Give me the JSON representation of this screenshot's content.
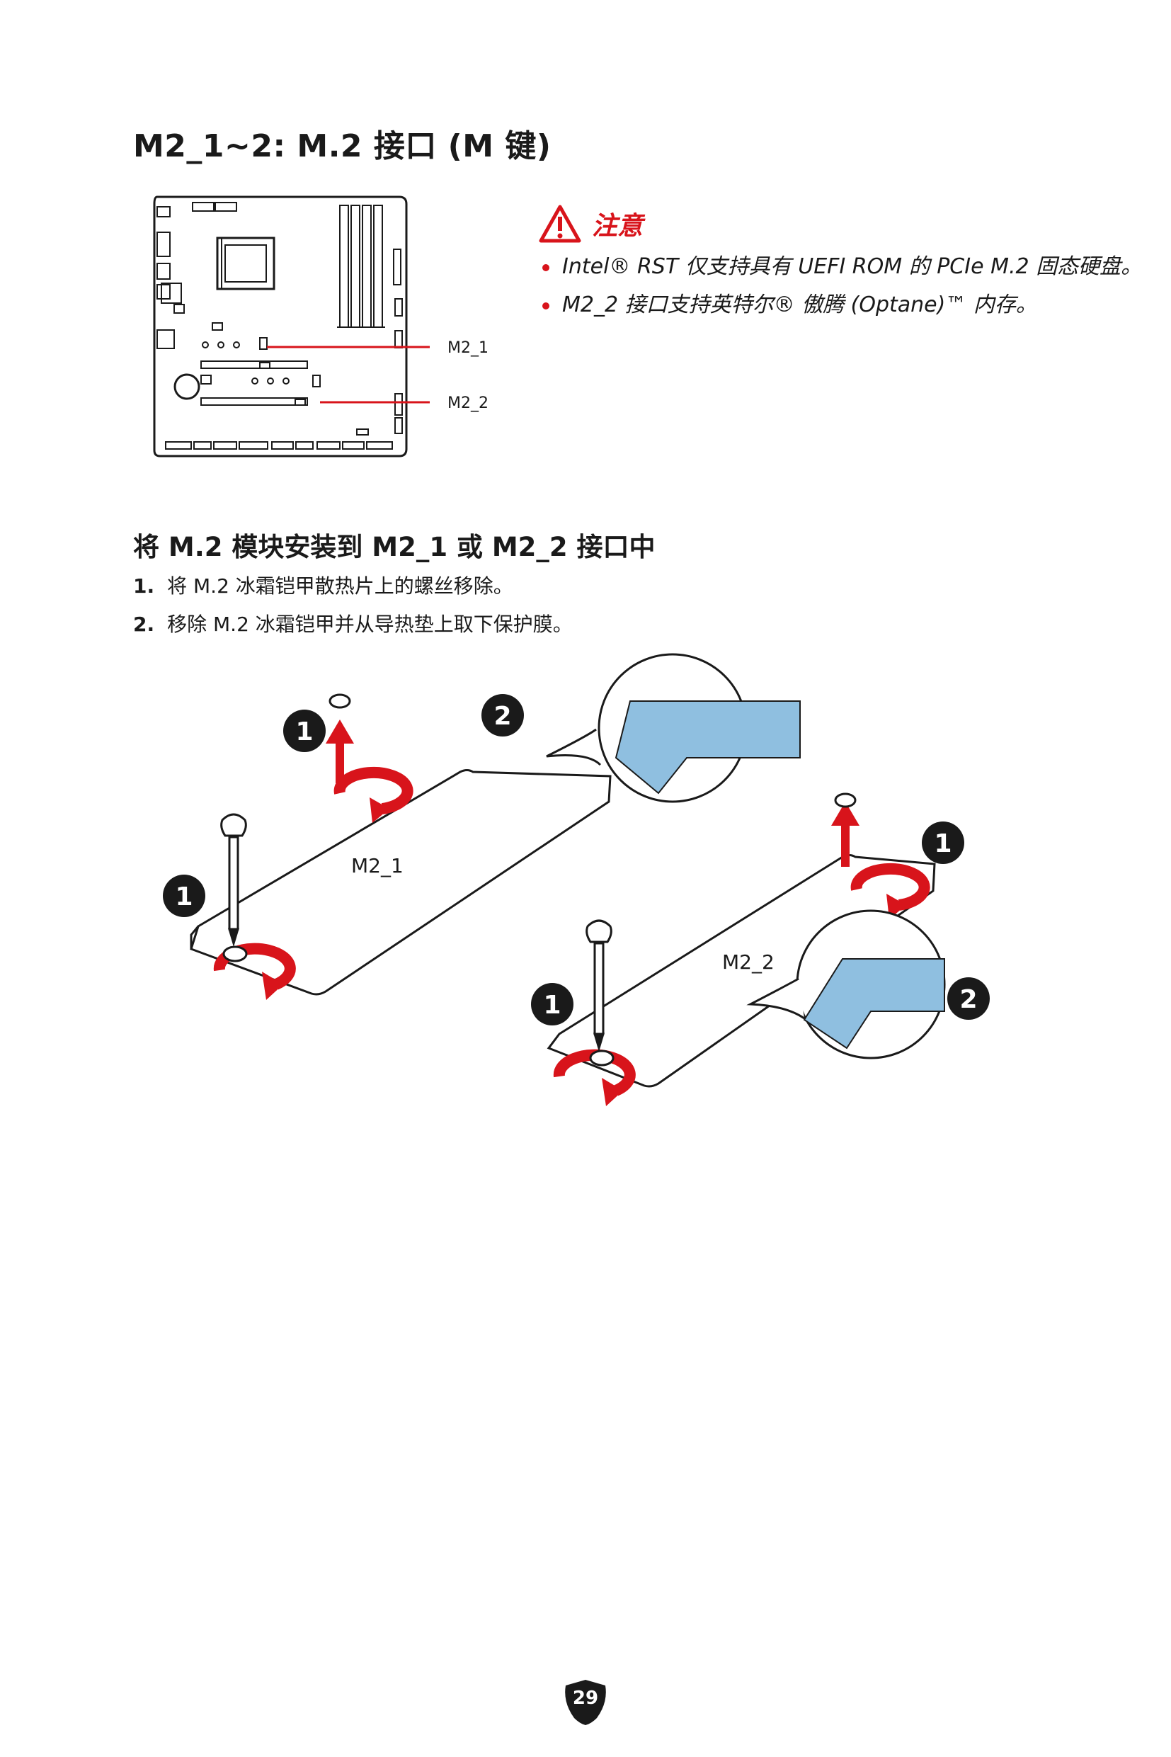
{
  "title": "M2_1~2: M.2 接口 (M 键)",
  "board": {
    "label_1": "M2_1",
    "label_2": "M2_2"
  },
  "caution": {
    "title": "注意",
    "notes": [
      "Intel® RST 仅支持具有 UEFI ROM 的 PCIe M.2 固态硬盘。",
      "M2_2 接口支持英特尔® 傲腾 (Optane)™ 内存。"
    ]
  },
  "install": {
    "title": "将 M.2 模块安装到 M2_1 或 M2_2 接口中",
    "steps": [
      {
        "num": "1.",
        "text": "将 M.2 冰霜铠甲散热片上的螺丝移除。"
      },
      {
        "num": "2.",
        "text": "移除 M.2 冰霜铠甲并从导热垫上取下保护膜。"
      }
    ]
  },
  "illustration": {
    "plate_1": "M2_1",
    "plate_2": "M2_2",
    "callout_1": "1",
    "callout_2": "2"
  },
  "page_number": "29",
  "colors": {
    "accent": "#d8141b",
    "pad": "#8fbfe0",
    "text": "#1a1a1a"
  }
}
